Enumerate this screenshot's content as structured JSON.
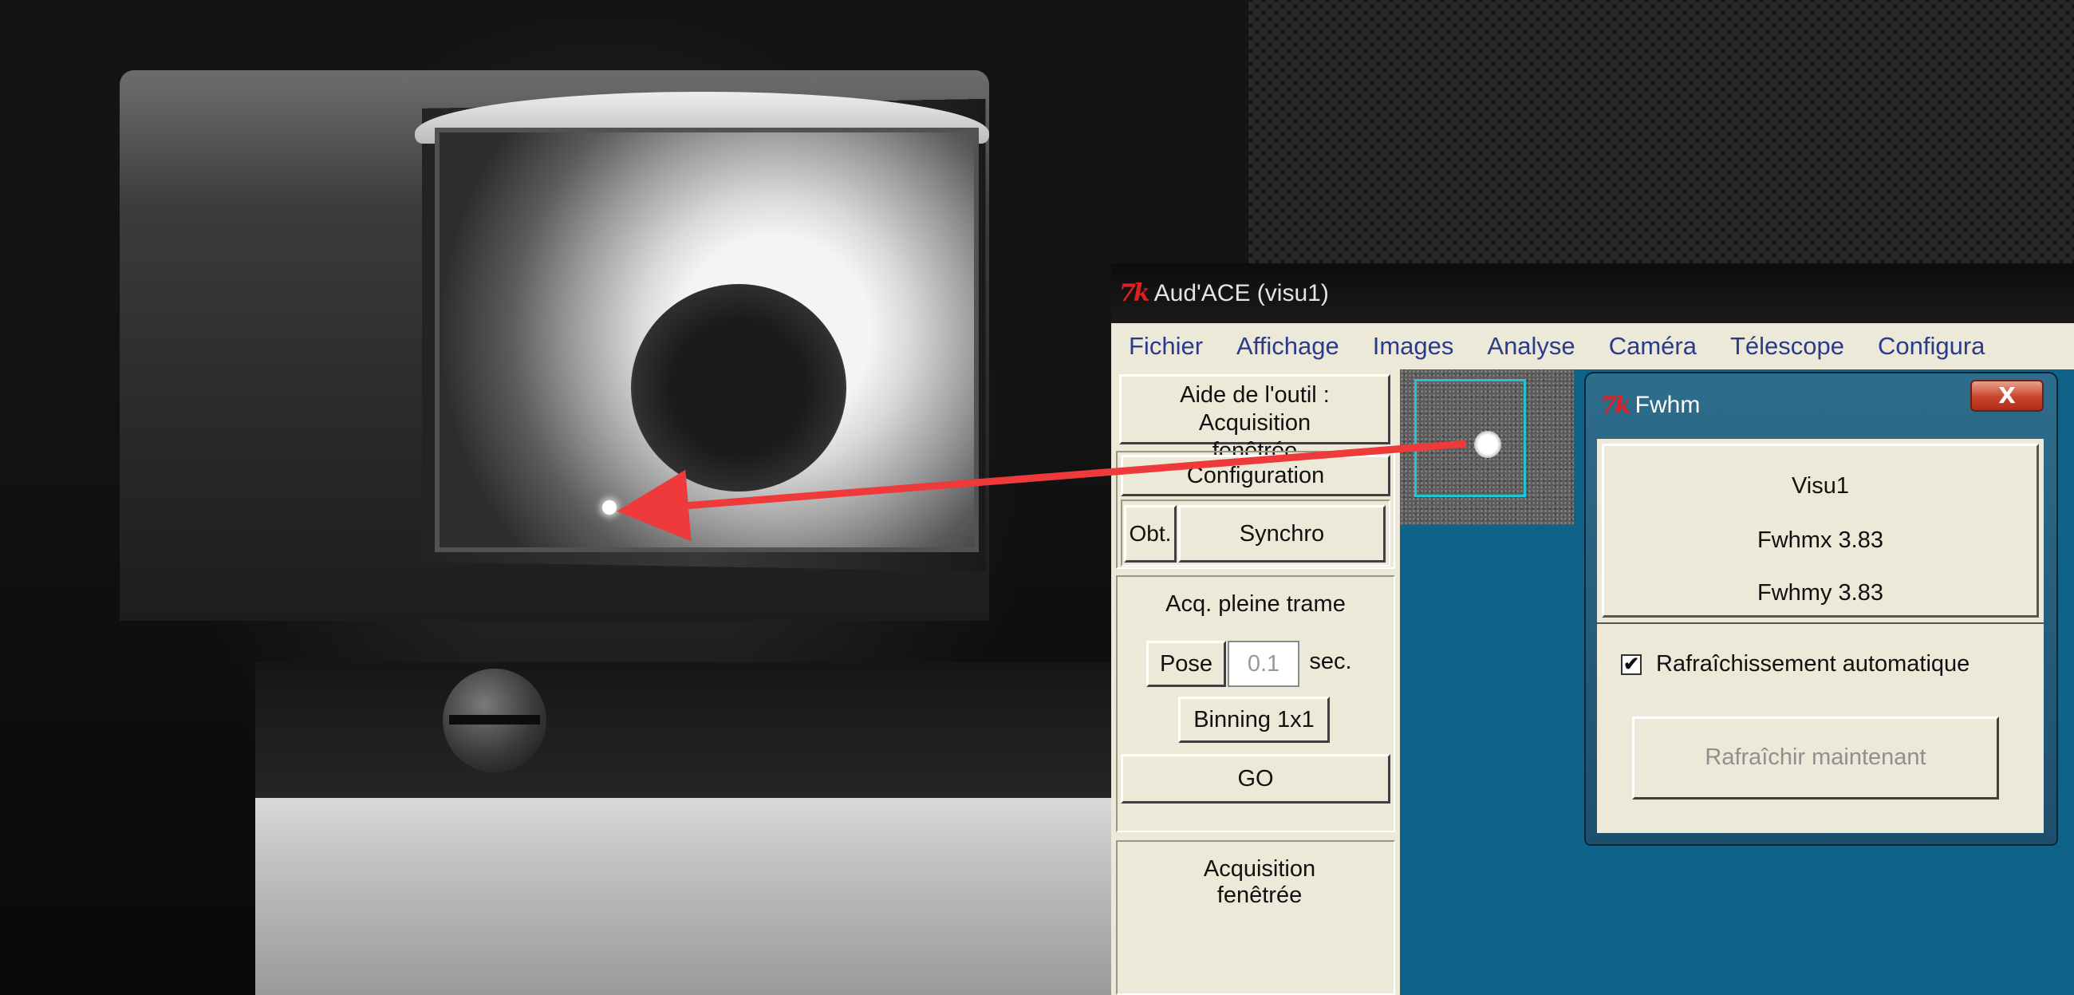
{
  "window": {
    "title": "Aud'ACE (visu1)",
    "logo": "7k"
  },
  "menu": [
    "Fichier",
    "Affichage",
    "Images",
    "Analyse",
    "Caméra",
    "Télescope",
    "Configura"
  ],
  "panel": {
    "help_button": "Aide de l'outil : Acquisition fenêtrée",
    "config_button": "Configuration",
    "shutter_button": "Obt.",
    "synchro_button": "Synchro",
    "fullframe_label": "Acq. pleine trame",
    "pose_button": "Pose",
    "pose_value": "0.1",
    "pose_unit": "sec.",
    "binning_button": "Binning 1x1",
    "go_button": "GO",
    "windowed_label": "Acquisition fenêtrée"
  },
  "fwhm": {
    "title": "Fwhm",
    "logo": "7k",
    "close_label": "X",
    "visu": "Visu1",
    "fwhmx": "Fwhmx 3.83",
    "fwhmy": "Fwhmy 3.83",
    "auto_refresh_label": "Rafraîchissement automatique",
    "auto_refresh_checked": true,
    "refresh_button": "Rafraîchir maintenant"
  },
  "colors": {
    "arrow": "#ee3a3a",
    "viewer_bg": "#0f6388",
    "roi_box": "#21c4d3"
  }
}
